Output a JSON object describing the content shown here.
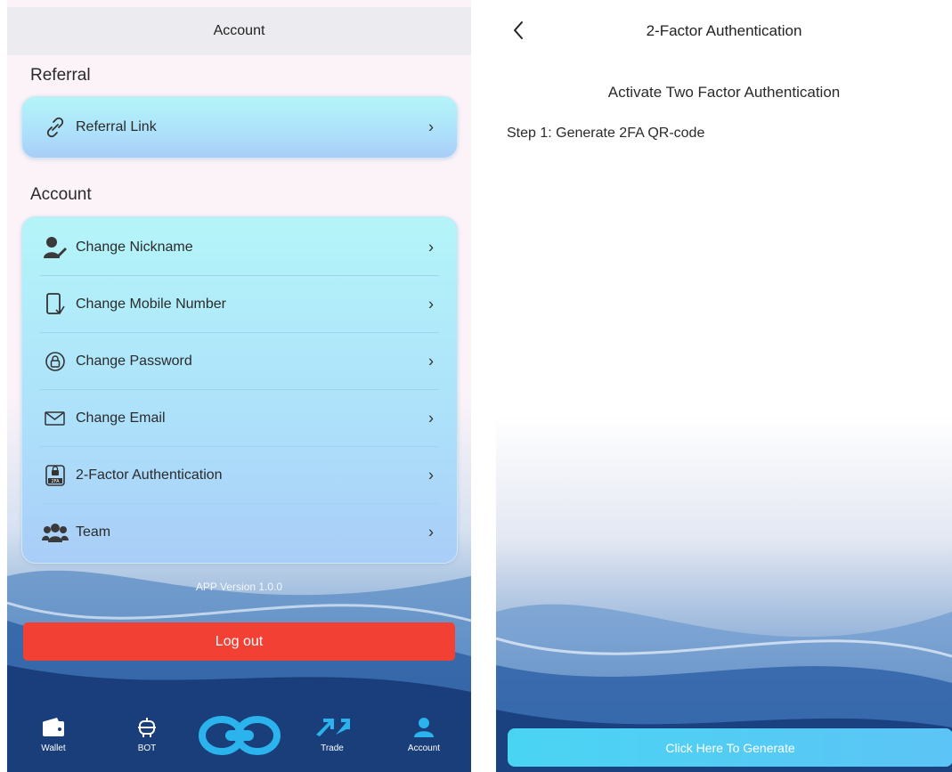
{
  "left": {
    "header_title": "Account",
    "referral_section": "Referral",
    "referral_item": "Referral Link",
    "account_section": "Account",
    "items": [
      {
        "label": "Change Nickname",
        "icon": "user-edit-icon"
      },
      {
        "label": "Change Mobile Number",
        "icon": "mobile-phone-icon"
      },
      {
        "label": "Change Password",
        "icon": "lock-refresh-icon"
      },
      {
        "label": "Change Email",
        "icon": "envelope-icon"
      },
      {
        "label": "2-Factor Authentication",
        "icon": "2fa-lock-icon"
      },
      {
        "label": "Team",
        "icon": "team-icon"
      }
    ],
    "version": "APP Version 1.0.0",
    "logout_label": "Log out",
    "tabs": [
      "Wallet",
      "BOT",
      "Trade",
      "Account"
    ]
  },
  "right": {
    "header_title": "2-Factor Authentication",
    "heading": "Activate Two Factor Authentication",
    "step1": "Step 1: Generate 2FA QR-code",
    "generate_label": "Click Here To Generate"
  },
  "colors": {
    "logout": "#f24034",
    "generate": "#4ad4f3",
    "card": "#b4f5f9"
  }
}
